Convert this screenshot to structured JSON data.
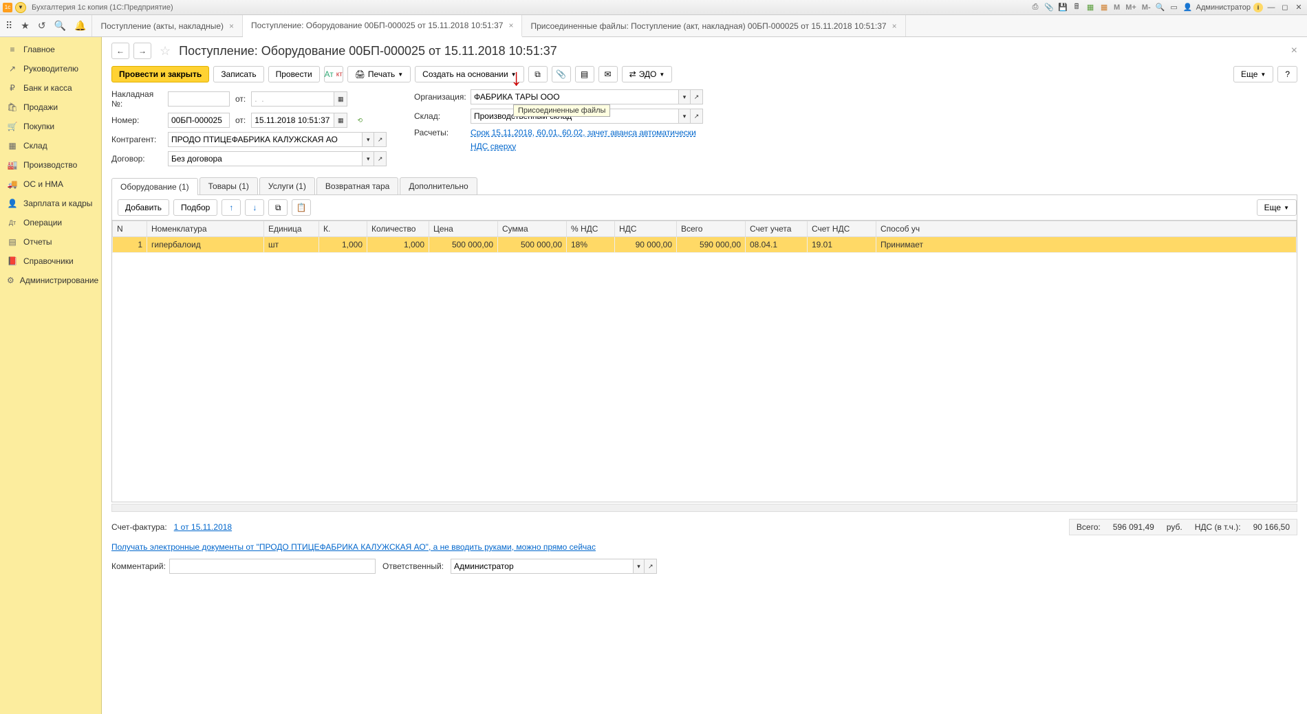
{
  "sysbar": {
    "app_title": "Бухгалтерия 1с копия  (1С:Предприятие)",
    "user": "Администратор",
    "m_icons": [
      "M",
      "M+",
      "M-"
    ]
  },
  "tabs": [
    {
      "label": "Поступление (акты, накладные)"
    },
    {
      "label": "Поступление: Оборудование 00БП-000025 от 15.11.2018 10:51:37",
      "active": true
    },
    {
      "label": "Присоединенные файлы: Поступление (акт, накладная) 00БП-000025 от 15.11.2018 10:51:37"
    }
  ],
  "sidebar": [
    {
      "icon": "≡",
      "label": "Главное"
    },
    {
      "icon": "↗",
      "label": "Руководителю"
    },
    {
      "icon": "₽",
      "label": "Банк и касса"
    },
    {
      "icon": "🛍",
      "label": "Продажи"
    },
    {
      "icon": "🛒",
      "label": "Покупки"
    },
    {
      "icon": "▦",
      "label": "Склад"
    },
    {
      "icon": "🏭",
      "label": "Производство"
    },
    {
      "icon": "🚚",
      "label": "ОС и НМА"
    },
    {
      "icon": "👤",
      "label": "Зарплата и кадры"
    },
    {
      "icon": "Дт",
      "label": "Операции"
    },
    {
      "icon": "▤",
      "label": "Отчеты"
    },
    {
      "icon": "📕",
      "label": "Справочники"
    },
    {
      "icon": "⚙",
      "label": "Администрирование"
    }
  ],
  "doc": {
    "title": "Поступление: Оборудование 00БП-000025 от 15.11.2018 10:51:37",
    "toolbar": {
      "post_close": "Провести и закрыть",
      "save": "Записать",
      "post": "Провести",
      "print": "Печать",
      "create_based": "Создать на основании",
      "edo": "ЭДО",
      "more": "Еще",
      "help": "?"
    },
    "tooltip": "Присоединенные файлы",
    "fields": {
      "invoice_no_label": "Накладная  №:",
      "invoice_no": "",
      "date_from_label": "от:",
      "invoice_date": ".  .",
      "number_label": "Номер:",
      "number": "00БП-000025",
      "number_date": "15.11.2018 10:51:37",
      "counterparty_label": "Контрагент:",
      "counterparty": "ПРОДО ПТИЦЕФАБРИКА КАЛУЖСКАЯ АО",
      "contract_label": "Договор:",
      "contract": "Без договора",
      "org_label": "Организация:",
      "org": "ФАБРИКА ТАРЫ ООО",
      "warehouse_label": "Склад:",
      "warehouse": "Производственный склад",
      "calc_label": "Расчеты:",
      "calc_link": "Срок 15.11.2018, 60.01, 60.02, зачет аванса автоматически",
      "vat_link": "НДС сверху"
    },
    "content_tabs": [
      "Оборудование (1)",
      "Товары (1)",
      "Услуги (1)",
      "Возвратная тара",
      "Дополнительно"
    ],
    "table_toolbar": {
      "add": "Добавить",
      "select": "Подбор",
      "more": "Еще"
    },
    "table": {
      "headers": [
        "N",
        "Номенклатура",
        "Единица",
        "К.",
        "Количество",
        "Цена",
        "Сумма",
        "% НДС",
        "НДС",
        "Всего",
        "Счет учета",
        "Счет НДС",
        "Способ уч"
      ],
      "rows": [
        {
          "n": "1",
          "item": "гипербалоид",
          "unit": "шт",
          "k": "1,000",
          "qty": "1,000",
          "price": "500 000,00",
          "sum": "500 000,00",
          "vat_rate": "18%",
          "vat": "90 000,00",
          "total": "590 000,00",
          "acc": "08.04.1",
          "vat_acc": "19.01",
          "method": "Принимает"
        }
      ]
    },
    "invoice_label": "Счет-фактура:",
    "invoice_link": "1 от 15.11.2018",
    "totals": {
      "total_label": "Всего:",
      "total": "596 091,49",
      "currency": "руб.",
      "vat_label": "НДС (в т.ч.):",
      "vat": "90 166,50"
    },
    "edo_link": "Получать электронные документы от \"ПРОДО ПТИЦЕФАБРИКА КАЛУЖСКАЯ АО\", а не вводить руками, можно прямо сейчас",
    "comment_label": "Комментарий:",
    "comment": "",
    "responsible_label": "Ответственный:",
    "responsible": "Администратор"
  }
}
